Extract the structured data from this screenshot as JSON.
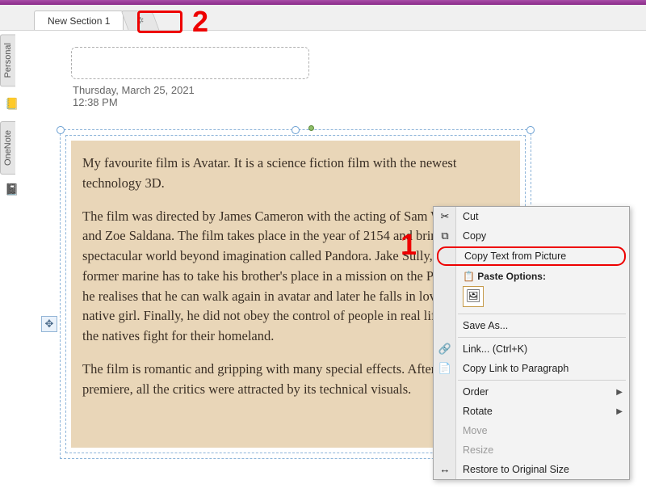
{
  "colors": {
    "accent": "#8a2b89",
    "annotation": "#ee0000",
    "image_bg": "#e9d6b8"
  },
  "tabs": {
    "active": "New Section 1",
    "loading_icon": "✲"
  },
  "side": {
    "personal": "Personal",
    "onenote": "OneNote"
  },
  "page": {
    "date": "Thursday, March 25, 2021",
    "time": "12:38 PM"
  },
  "image_text": {
    "p1": "My favourite film is Avatar. It is a science fiction film with the newest technology 3D.",
    "p2": "The film was directed by James Cameron with the acting of Sam Worthington and Zoe Saldana. The film takes place in the year of 2154 and brings us to a spectacular world beyond imagination called Pandora. Jake Sully, a disabled former marine has to take his brother's place in a mission on the Pandora. Later, he realises that he can walk again in avatar and later he falls in love with a native girl. Finally, he did not obey the control of people in real life, he helps the natives fight for their homeland.",
    "p3": "The film is romantic and gripping with many special effects. After the premiere, all the critics were attracted by its technical visuals."
  },
  "menu": {
    "cut": "Cut",
    "copy": "Copy",
    "copy_text": "Copy Text from Picture",
    "paste_label": "Paste Options:",
    "save_as": "Save As...",
    "link": "Link... (Ctrl+K)",
    "copy_link": "Copy Link to Paragraph",
    "order": "Order",
    "rotate": "Rotate",
    "move": "Move",
    "resize": "Resize",
    "restore": "Restore to Original Size"
  },
  "annotations": {
    "one": "1",
    "two": "2"
  },
  "icons": {
    "cut": "✂",
    "copy": "⧉",
    "paste": "📋",
    "paste_img": "🖼",
    "link": "🔗",
    "copy_link": "📄",
    "restore": "↔",
    "move_handle": "✥"
  }
}
